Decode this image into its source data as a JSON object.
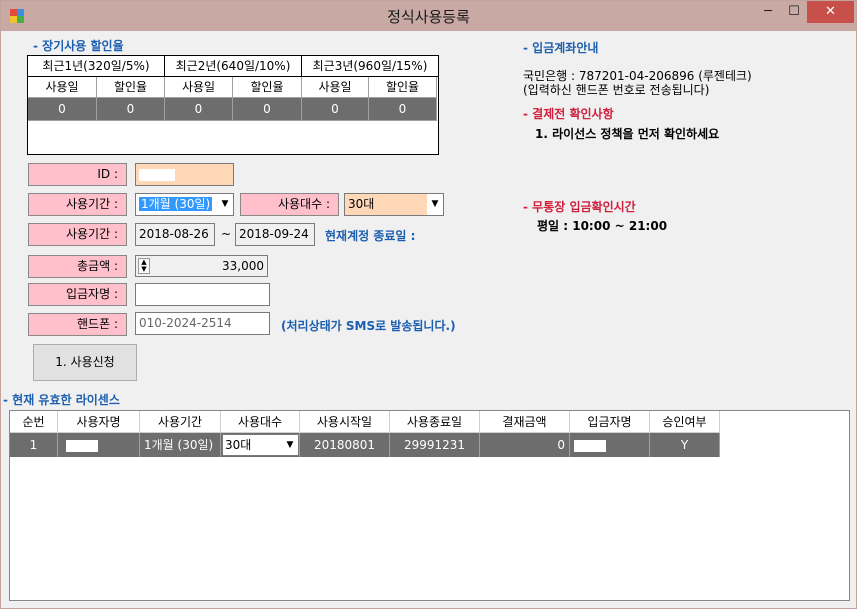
{
  "window": {
    "title": "정식사용등록",
    "min_label": "─",
    "max_label": "☐",
    "close_label": "✕"
  },
  "discount": {
    "heading": "- 장기사용 할인율",
    "periods": [
      "최근1년(320일/5%)",
      "최근2년(640일/10%)",
      "최근3년(960일/15%)"
    ],
    "sub_headers": [
      "사용일",
      "할인율",
      "사용일",
      "할인율",
      "사용일",
      "할인율"
    ],
    "values": [
      "0",
      "0",
      "0",
      "0",
      "0",
      "0"
    ]
  },
  "form": {
    "id_label": "ID :",
    "id_value": "",
    "period_label": "사용기간 :",
    "period_value": "1개월 (30일)",
    "count_label": "사용대수 :",
    "count_value": "30대",
    "date_label": "사용기간 :",
    "date_start": "2018-08-26",
    "date_sep": "~",
    "date_end": "2018-09-24",
    "expire_note": "현재계정 종료일 :",
    "total_label": "총금액 :",
    "total_value": "33,000",
    "depositor_label": "입금자명 :",
    "depositor_value": "",
    "phone_label": "핸드폰 :",
    "phone_value": "010-2024-2514",
    "sms_note": "(처리상태가 SMS로 발송됩니다.)",
    "apply_button": "1. 사용신청"
  },
  "bank": {
    "heading": "- 입금계좌안내",
    "account": "국민은행 : 787201-04-206896 (루젠테크)",
    "note": "(입력하신 핸드폰 번호로 전송됩니다)"
  },
  "precheck": {
    "heading": "- 결제전 확인사항",
    "item": "1. 라이선스 정책을 먼저 확인하세요"
  },
  "deposit_time": {
    "heading": "- 무통장 입금확인시간",
    "hours": "평일 : 10:00 ~ 21:00"
  },
  "licenses": {
    "heading": "- 현재 유효한 라이센스",
    "columns": [
      "순번",
      "사용자명",
      "사용기간",
      "사용대수",
      "사용시작일",
      "사용종료일",
      "결재금액",
      "입금자명",
      "승인여부"
    ],
    "rows": [
      {
        "no": "1",
        "user": "",
        "period": "1개월 (30일)",
        "count": "30대",
        "start": "20180801",
        "end": "29991231",
        "amount": "0",
        "depositor": "",
        "approved": "Y"
      }
    ]
  }
}
